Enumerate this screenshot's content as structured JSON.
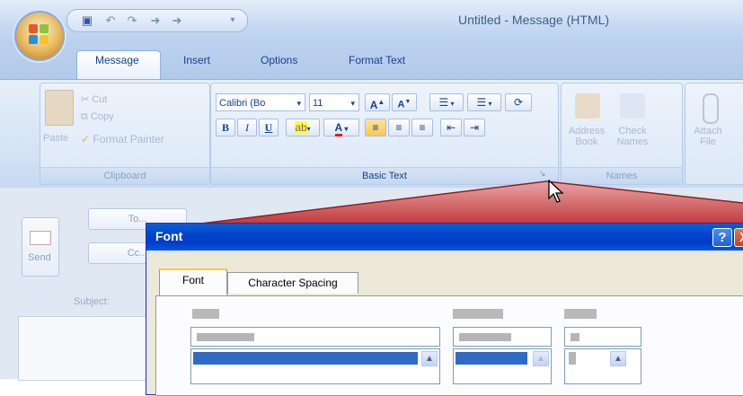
{
  "window": {
    "title": "Untitled - Message (HTML)"
  },
  "tabs": [
    {
      "label": "Message"
    },
    {
      "label": "Insert"
    },
    {
      "label": "Options"
    },
    {
      "label": "Format Text"
    }
  ],
  "ribbon": {
    "clipboard": {
      "label": "Clipboard",
      "paste": "Paste",
      "cut": "Cut",
      "copy": "Copy",
      "format_painter": "Format Painter"
    },
    "basic_text": {
      "label": "Basic Text",
      "font_name": "Calibri (Bo",
      "font_size": "11"
    },
    "names": {
      "label": "Names",
      "address_book_1": "Address",
      "address_book_2": "Book",
      "check_names_1": "Check",
      "check_names_2": "Names"
    },
    "attach": {
      "line1": "Attach",
      "line2": "File"
    }
  },
  "compose": {
    "send": "Send",
    "to": "To...",
    "cc": "Cc...",
    "subject": "Subject:"
  },
  "dialog": {
    "title": "Font",
    "help": "?",
    "close": "X",
    "tabs": [
      {
        "label": "Font"
      },
      {
        "label": "Character Spacing"
      }
    ]
  },
  "icons": {
    "office_button": "office-logo-icon",
    "save": "save-icon",
    "undo": "undo-icon",
    "redo": "redo-icon"
  },
  "colors": {
    "ribbon_bg": "#d3e2f4",
    "dialog_title": "#0446c9",
    "callout_red": "#c0282a",
    "selection": "#316ac5"
  }
}
